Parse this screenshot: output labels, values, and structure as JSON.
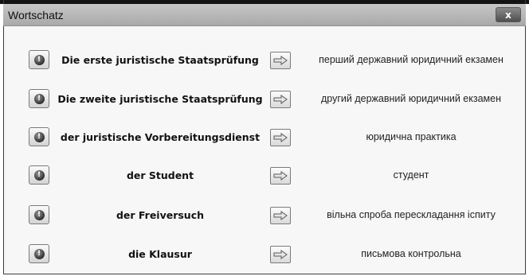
{
  "window": {
    "title": "Wortschatz",
    "close_label": "x"
  },
  "icons": {
    "info": "info-bulb-icon",
    "arrow": "arrow-right-icon",
    "info_glyph": "!"
  },
  "entries": [
    {
      "de": "Die erste juristische Staatsprüfung",
      "uk": "перший державний юридичний екзамен"
    },
    {
      "de": "Die zweite juristische Staatsprüfung",
      "uk": "другий державний юридичний екзамен"
    },
    {
      "de": "der juristische Vorbereitungsdienst",
      "uk": "юридична практика"
    },
    {
      "de": "der Student",
      "uk": "студент"
    },
    {
      "de": "der Freiversuch",
      "uk": "вільна спроба перескладання іспиту"
    },
    {
      "de": "die Klausur",
      "uk": "письмова контрольна"
    }
  ]
}
